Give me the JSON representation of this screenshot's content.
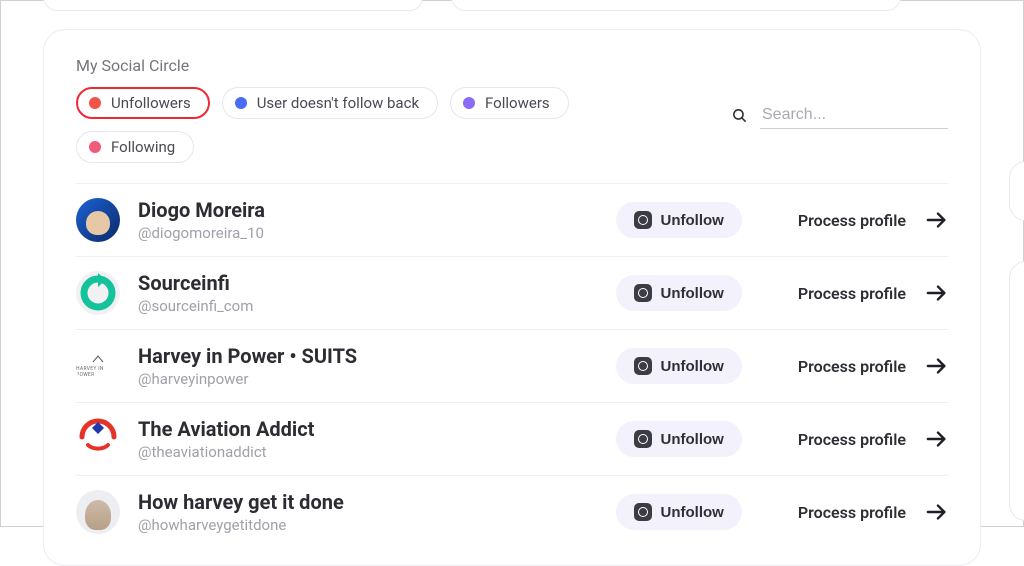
{
  "colors": {
    "red": "#f15449",
    "blue": "#4a6cf5",
    "purple": "#8a6cf5",
    "pink": "#f05b7a"
  },
  "header": {
    "title": "My Social Circle"
  },
  "tabs": [
    {
      "id": "unfollowers",
      "label": "Unfollowers",
      "dot": "red",
      "selected": true
    },
    {
      "id": "no-followback",
      "label": "User doesn't follow back",
      "dot": "blue",
      "selected": false
    },
    {
      "id": "followers",
      "label": "Followers",
      "dot": "purple",
      "selected": false
    },
    {
      "id": "following",
      "label": "Following",
      "dot": "pink",
      "selected": false
    }
  ],
  "search": {
    "placeholder": "Search..."
  },
  "action_labels": {
    "unfollow": "Unfollow",
    "process": "Process profile"
  },
  "users": [
    {
      "name": "Diogo Moreira",
      "handle": "@diogomoreira_10"
    },
    {
      "name": "Sourceinfi",
      "handle": "@sourceinfi_com"
    },
    {
      "name": "Harvey in Power • SUITS",
      "handle": "@harveyinpower"
    },
    {
      "name": "The Aviation Addict",
      "handle": "@theaviationaddict"
    },
    {
      "name": "How harvey get it done",
      "handle": "@howharveygetitdone"
    }
  ]
}
